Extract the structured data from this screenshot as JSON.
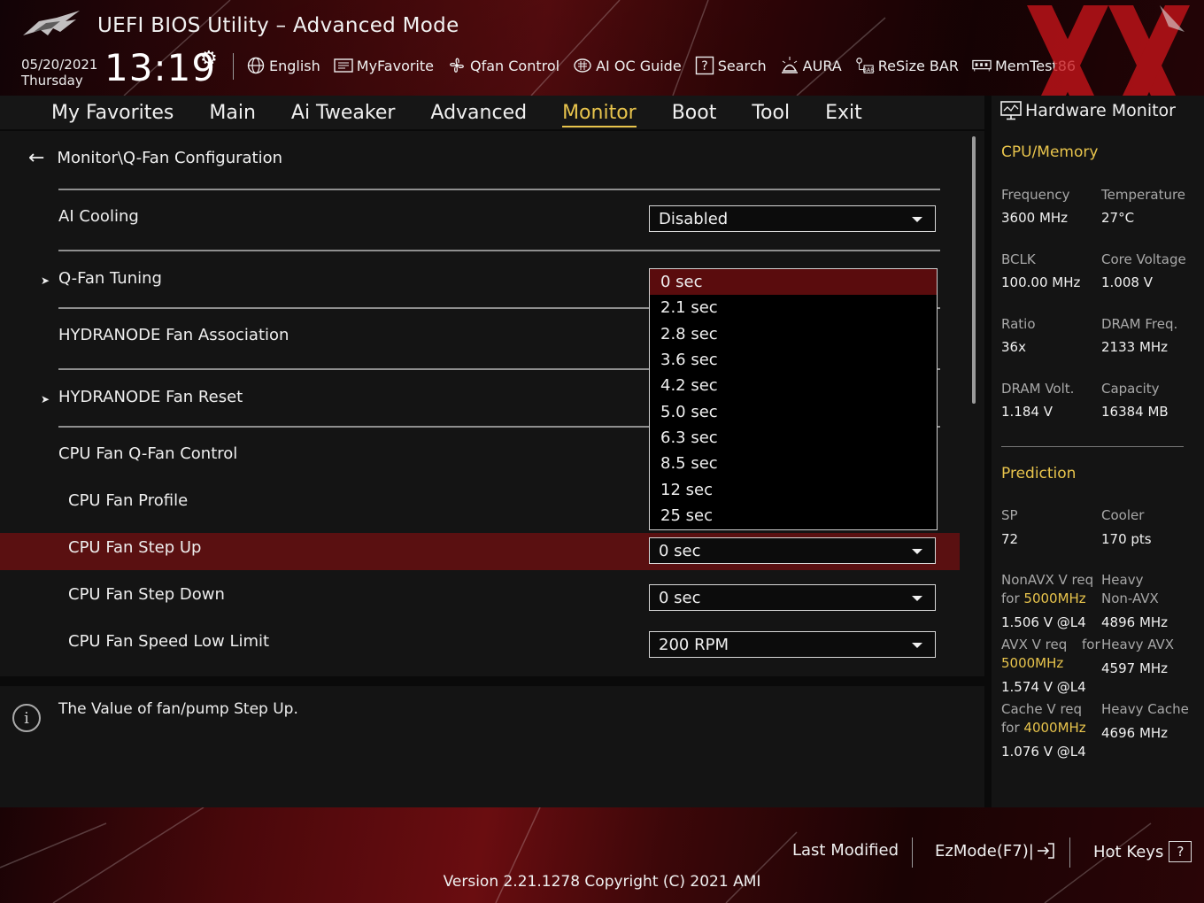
{
  "header": {
    "title": "UEFI BIOS Utility – Advanced Mode",
    "date": "05/20/2021",
    "day": "Thursday",
    "time": "13:19",
    "toolbar": [
      {
        "label": "English",
        "icon": "globe-icon"
      },
      {
        "label": "MyFavorite",
        "icon": "favorite-list-icon"
      },
      {
        "label": "Qfan Control",
        "icon": "fan-icon"
      },
      {
        "label": "AI OC Guide",
        "icon": "ai-chip-icon"
      },
      {
        "label": "Search",
        "icon": "search-help-icon"
      },
      {
        "label": "AURA",
        "icon": "aura-light-icon"
      },
      {
        "label": "ReSize BAR",
        "icon": "resize-bar-icon"
      },
      {
        "label": "MemTest86",
        "icon": "memory-icon"
      }
    ]
  },
  "menu": {
    "tabs": [
      "My Favorites",
      "Main",
      "Ai Tweaker",
      "Advanced",
      "Monitor",
      "Boot",
      "Tool",
      "Exit"
    ],
    "active": "Monitor"
  },
  "main": {
    "breadcrumb": "Monitor\\Q-Fan Configuration",
    "items": {
      "ai_cooling": {
        "label": "AI Cooling",
        "value": "Disabled"
      },
      "qfan_tuning": {
        "label": "Q-Fan Tuning"
      },
      "hydranode_assoc": {
        "label": "HYDRANODE Fan Association"
      },
      "hydranode_reset": {
        "label": "HYDRANODE Fan Reset"
      },
      "cpu_fan_control": {
        "label": "CPU Fan Q-Fan Control"
      },
      "cpu_fan_profile": {
        "label": "CPU Fan Profile"
      },
      "cpu_fan_step_up": {
        "label": "CPU Fan Step Up",
        "value": "0 sec"
      },
      "cpu_fan_step_down": {
        "label": "CPU Fan Step Down",
        "value": "0 sec"
      },
      "cpu_fan_low_limit": {
        "label": "CPU Fan Speed Low Limit",
        "value": "200 RPM"
      }
    },
    "dropdown": {
      "options": [
        "0 sec",
        "2.1 sec",
        "2.8 sec",
        "3.6 sec",
        "4.2 sec",
        "5.0 sec",
        "6.3 sec",
        "8.5 sec",
        "12 sec",
        "25 sec"
      ],
      "selected": "0 sec"
    }
  },
  "help": {
    "text": "The Value of fan/pump Step Up."
  },
  "hw_monitor": {
    "title": "Hardware Monitor",
    "cpu_memory": {
      "heading": "CPU/Memory",
      "frequency": {
        "label": "Frequency",
        "value": "3600 MHz"
      },
      "temperature": {
        "label": "Temperature",
        "value": "27°C"
      },
      "bclk": {
        "label": "BCLK",
        "value": "100.00 MHz"
      },
      "core_voltage": {
        "label": "Core Voltage",
        "value": "1.008 V"
      },
      "ratio": {
        "label": "Ratio",
        "value": "36x"
      },
      "dram_freq": {
        "label": "DRAM Freq.",
        "value": "2133 MHz"
      },
      "dram_volt": {
        "label": "DRAM Volt.",
        "value": "1.184 V"
      },
      "capacity": {
        "label": "Capacity",
        "value": "16384 MB"
      }
    },
    "prediction": {
      "heading": "Prediction",
      "sp": {
        "label": "SP",
        "value": "72"
      },
      "cooler": {
        "label": "Cooler",
        "value": "170 pts"
      },
      "nonavx_req_1": "NonAVX V req",
      "nonavx_req_for": "for",
      "nonavx_req_freq": "5000MHz",
      "nonavx_req_value": "1.506 V @L4",
      "heavy_nonavx_1": "Heavy",
      "heavy_nonavx_2": "Non-AVX",
      "heavy_nonavx_value": "4896 MHz",
      "avx_req_1": "AVX V req",
      "avx_req_for": "for",
      "avx_req_freq": "5000MHz",
      "avx_req_value": "1.574 V @L4",
      "heavy_avx": "Heavy AVX",
      "heavy_avx_value": "4597 MHz",
      "cache_req_1": "Cache V req",
      "cache_req_for": "for",
      "cache_req_freq": "4000MHz",
      "cache_req_value": "1.076 V @L4",
      "heavy_cache": "Heavy Cache",
      "heavy_cache_value": "4696 MHz"
    }
  },
  "footer": {
    "last_modified": "Last Modified",
    "ezmode": "EzMode(F7)|",
    "hot_keys": "Hot Keys",
    "hot_keys_glyph": "?",
    "version": "Version 2.21.1278 Copyright (C) 2021 AMI"
  },
  "colors": {
    "accent": "#e8c44c",
    "highlight_row": "#5a1011",
    "selected_option": "#5a0c0d",
    "brand_red": "#c8141a"
  }
}
